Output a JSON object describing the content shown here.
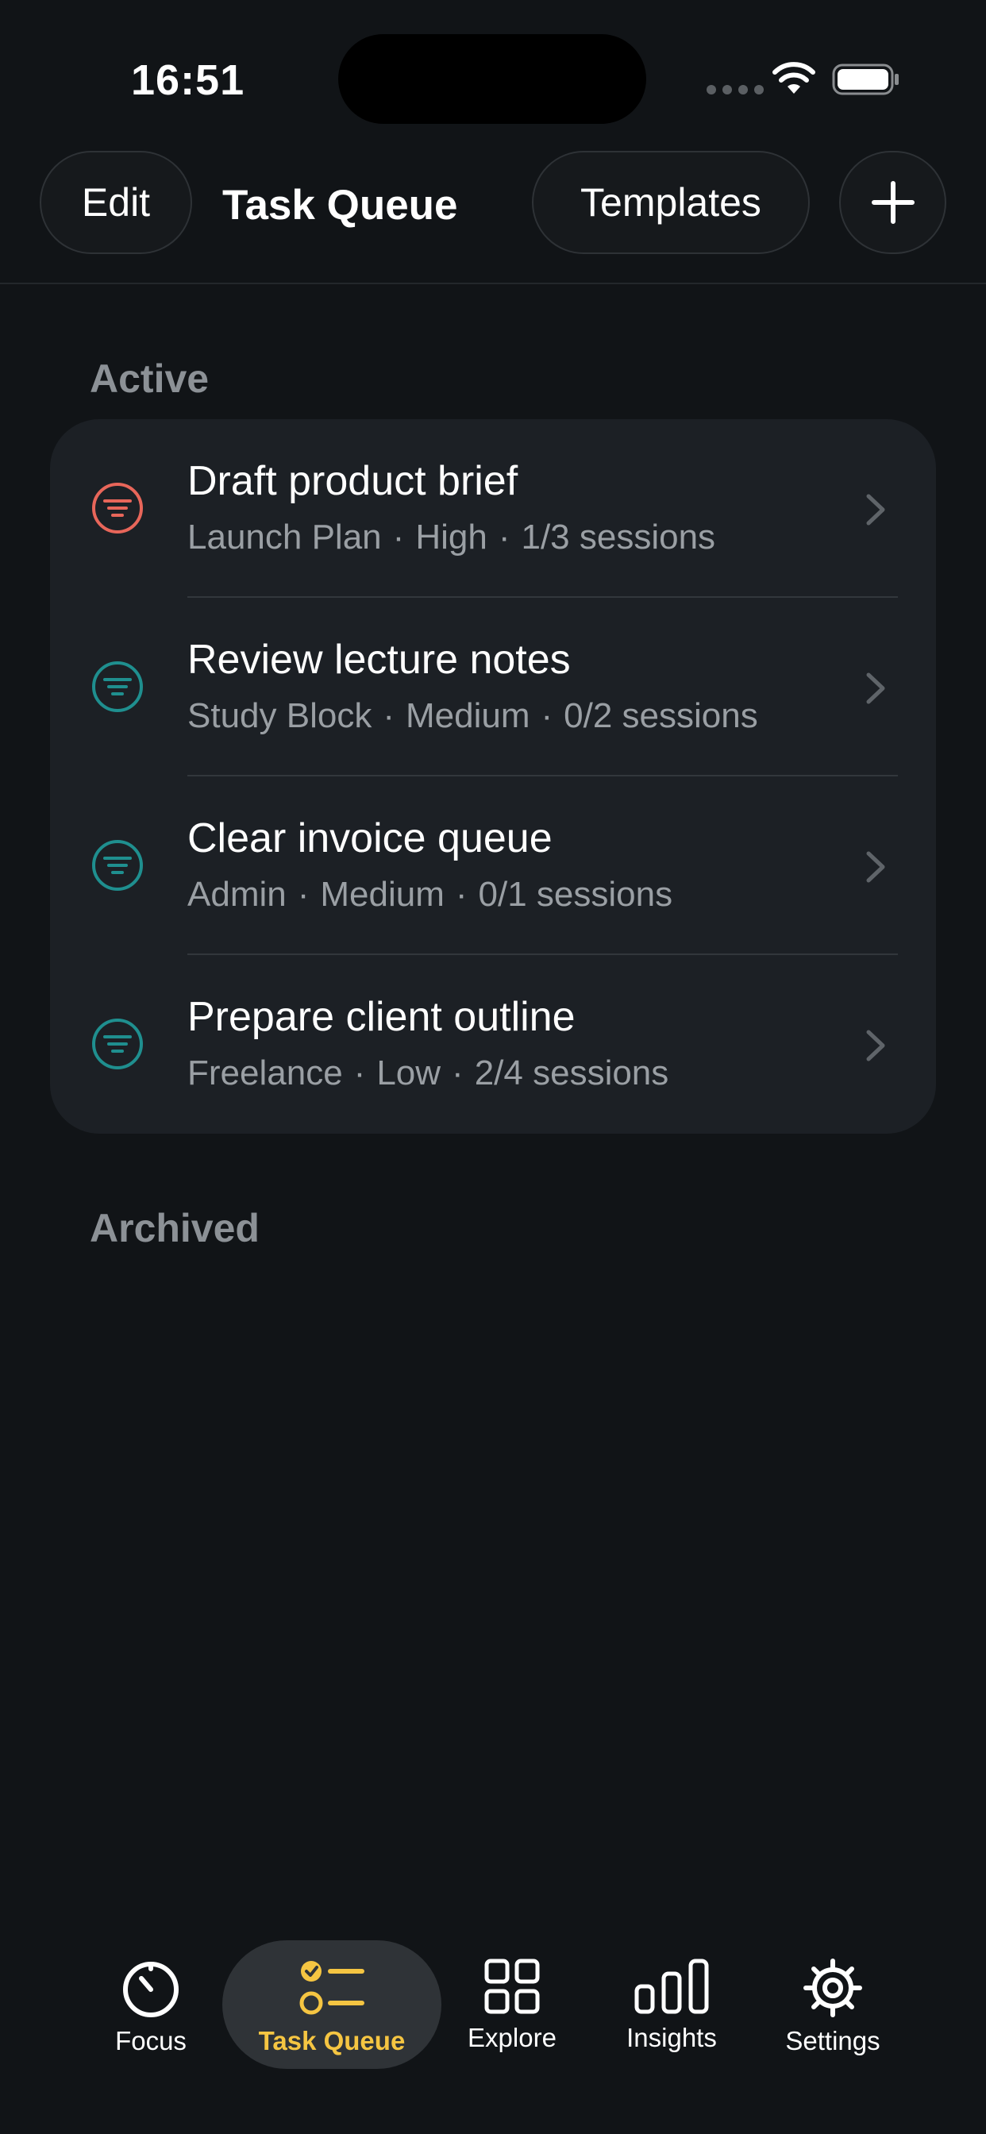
{
  "status_bar": {
    "time": "16:51"
  },
  "header": {
    "edit_label": "Edit",
    "title": "Task Queue",
    "templates_label": "Templates"
  },
  "sections": {
    "active_label": "Active",
    "archived_label": "Archived"
  },
  "tasks": [
    {
      "title": "Draft product brief",
      "project": "Launch Plan",
      "priority": "High",
      "sessions": "1/3 sessions",
      "icon_color": "#e8665a"
    },
    {
      "title": "Review lecture notes",
      "project": "Study Block",
      "priority": "Medium",
      "sessions": "0/2 sessions",
      "icon_color": "#1f8f8f"
    },
    {
      "title": "Clear invoice queue",
      "project": "Admin",
      "priority": "Medium",
      "sessions": "0/1 sessions",
      "icon_color": "#1f8f8f"
    },
    {
      "title": "Prepare client outline",
      "project": "Freelance",
      "priority": "Low",
      "sessions": "2/4 sessions",
      "icon_color": "#1f8f8f"
    }
  ],
  "tab_bar": {
    "tabs": [
      {
        "label": "Focus",
        "icon": "timer-icon"
      },
      {
        "label": "Task Queue",
        "icon": "checklist-icon",
        "selected": true
      },
      {
        "label": "Explore",
        "icon": "grid-icon"
      },
      {
        "label": "Insights",
        "icon": "bar-chart-icon"
      },
      {
        "label": "Settings",
        "icon": "gear-icon"
      }
    ]
  },
  "colors": {
    "background": "#111417",
    "card": "#1c2025",
    "accent": "#f5c542",
    "high_priority": "#e8665a",
    "normal_priority": "#1f8f8f"
  }
}
